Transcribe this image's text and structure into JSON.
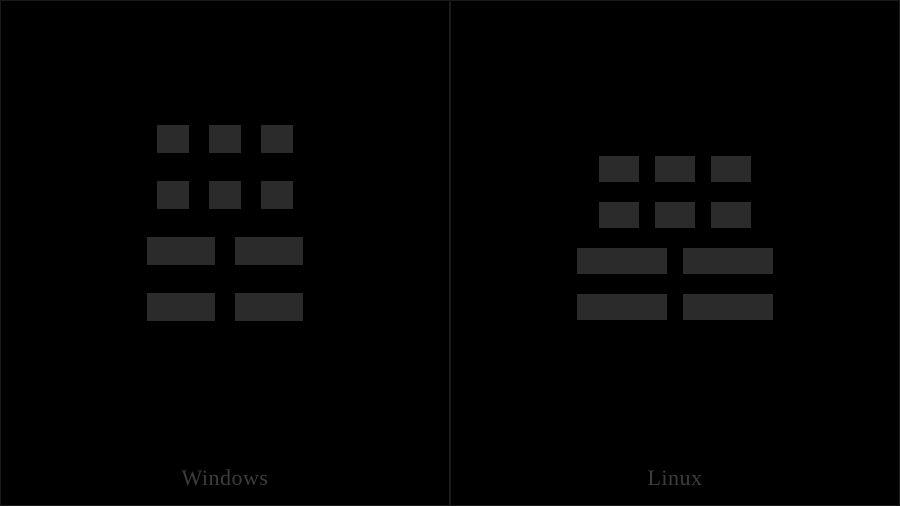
{
  "panels": {
    "left": {
      "caption": "Windows"
    },
    "right": {
      "caption": "Linux"
    }
  },
  "glyph": {
    "rows": [
      {
        "segments": [
          "short",
          "short",
          "short"
        ]
      },
      {
        "segments": [
          "short",
          "short",
          "short"
        ]
      },
      {
        "segments": [
          "long",
          "long"
        ]
      },
      {
        "segments": [
          "long",
          "long"
        ]
      }
    ]
  }
}
